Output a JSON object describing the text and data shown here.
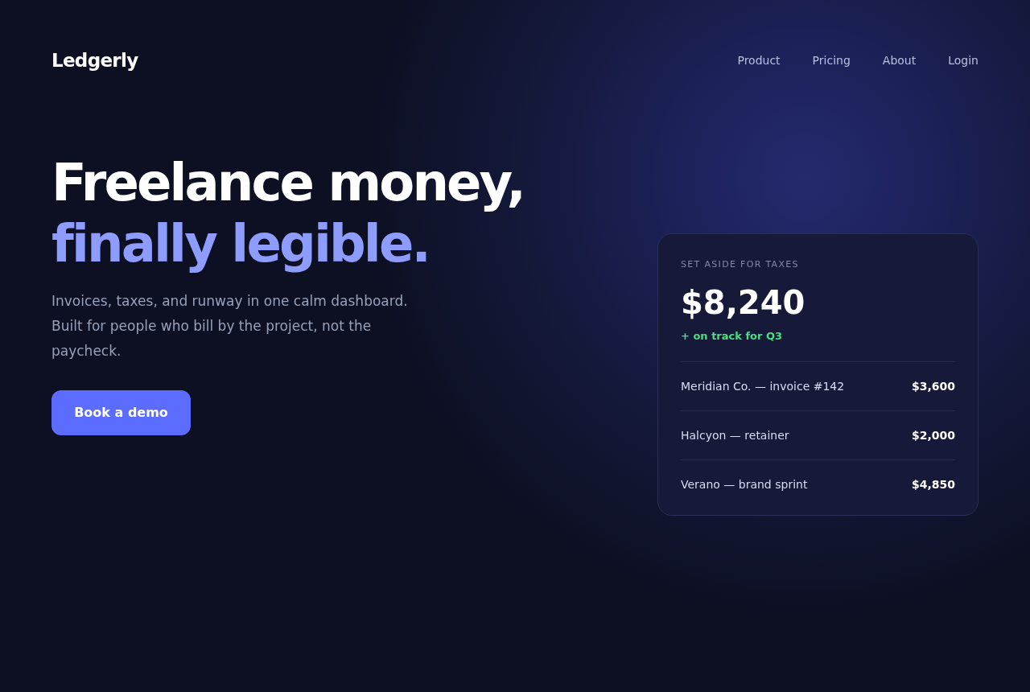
{
  "brand": {
    "name": "Ledgerly"
  },
  "nav": {
    "links": [
      "Product",
      "Pricing",
      "About",
      "Login"
    ]
  },
  "hero": {
    "headline": "Freelance money,",
    "headline_accent": "finally legible.",
    "subtitle": "Invoices, taxes, and runway in one calm dashboard. Built for people who bill by the project, not the paycheck.",
    "cta": "Book a demo"
  },
  "card": {
    "label": "SET ASIDE FOR TAXES",
    "amount": "$8,240",
    "status": "+ on track for Q3",
    "rows": [
      {
        "description": "Meridian Co. — invoice #142",
        "amount": "$3,600"
      },
      {
        "description": "Halcyon — retainer",
        "amount": "$2,000"
      },
      {
        "description": "Verano — brand sprint",
        "amount": "$4,850"
      }
    ]
  }
}
